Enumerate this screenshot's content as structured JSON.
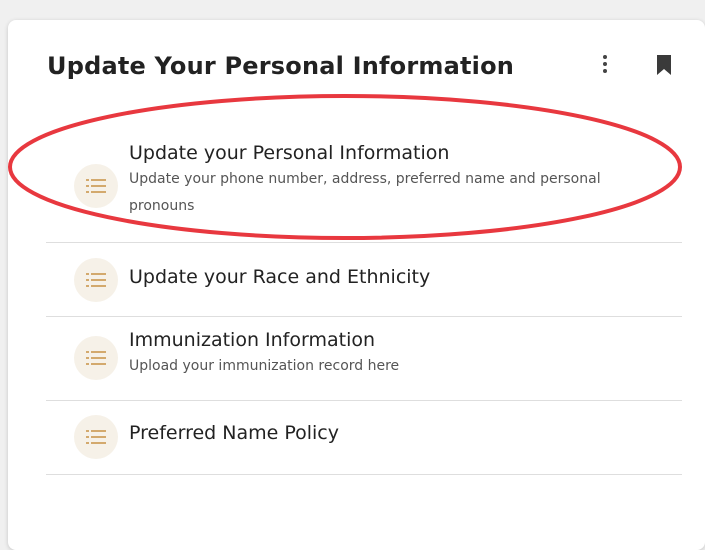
{
  "card": {
    "title": "Update Your Personal Information"
  },
  "actions": {
    "menu_icon": "kebab-menu-icon",
    "bookmark_icon": "bookmark-icon"
  },
  "items": [
    {
      "title": "Update your Personal Information",
      "description": "Update your phone number, address, preferred name and personal pronouns",
      "icon": "list-icon"
    },
    {
      "title": "Update your Race and Ethnicity",
      "description": "",
      "icon": "list-icon"
    },
    {
      "title": "Immunization Information",
      "description": "Upload your immunization record here",
      "icon": "list-icon"
    },
    {
      "title": "Preferred Name Policy",
      "description": "",
      "icon": "list-icon"
    }
  ],
  "colors": {
    "icon_tint": "#d3a96d",
    "icon_circle": "#f6f1e8",
    "annotation_red": "#e8383f",
    "text_primary": "#222222"
  }
}
